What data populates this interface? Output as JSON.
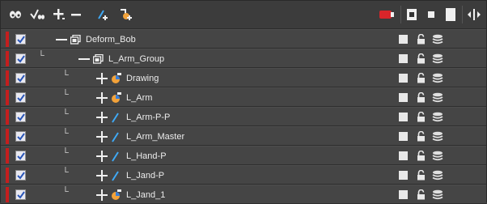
{
  "toolbar": {
    "icons": [
      "show-all-icon",
      "enable-all-icon",
      "add-layer-icon",
      "delete-layer-icon",
      "add-peg-icon",
      "add-drawing-icon",
      "layer-color-icon",
      "thumbnail-large-icon",
      "thumbnail-small-icon",
      "thumbnail-off-icon",
      "expand-collapse-icon"
    ]
  },
  "colors": {
    "active_bar": "#c41e1e",
    "drawing_icon_orange": "#f2a23a",
    "drawing_icon_blue": "#3a7fd8",
    "peg_icon": "#3fa9f5"
  },
  "layers": [
    {
      "name": "Deform_Bob",
      "type": "group",
      "expander": "minus",
      "checked": true,
      "tree_mark": ""
    },
    {
      "name": "L_Arm_Group",
      "type": "group",
      "expander": "minus",
      "checked": true,
      "tree_mark": "└"
    },
    {
      "name": "Drawing",
      "type": "drawing",
      "expander": "plus",
      "checked": true,
      "tree_mark": "└"
    },
    {
      "name": "L_Arm",
      "type": "drawing",
      "expander": "plus",
      "checked": true,
      "tree_mark": "└"
    },
    {
      "name": "L_Arm-P-P",
      "type": "peg",
      "expander": "plus",
      "checked": true,
      "tree_mark": "└"
    },
    {
      "name": "L_Arm_Master",
      "type": "peg",
      "expander": "plus",
      "checked": true,
      "tree_mark": "└"
    },
    {
      "name": "L_Hand-P",
      "type": "peg",
      "expander": "plus",
      "checked": true,
      "tree_mark": "└"
    },
    {
      "name": "L_Jand-P",
      "type": "peg",
      "expander": "plus",
      "checked": true,
      "tree_mark": "└"
    },
    {
      "name": "L_Jand_1",
      "type": "drawing",
      "expander": "plus",
      "checked": true,
      "tree_mark": "└"
    }
  ]
}
